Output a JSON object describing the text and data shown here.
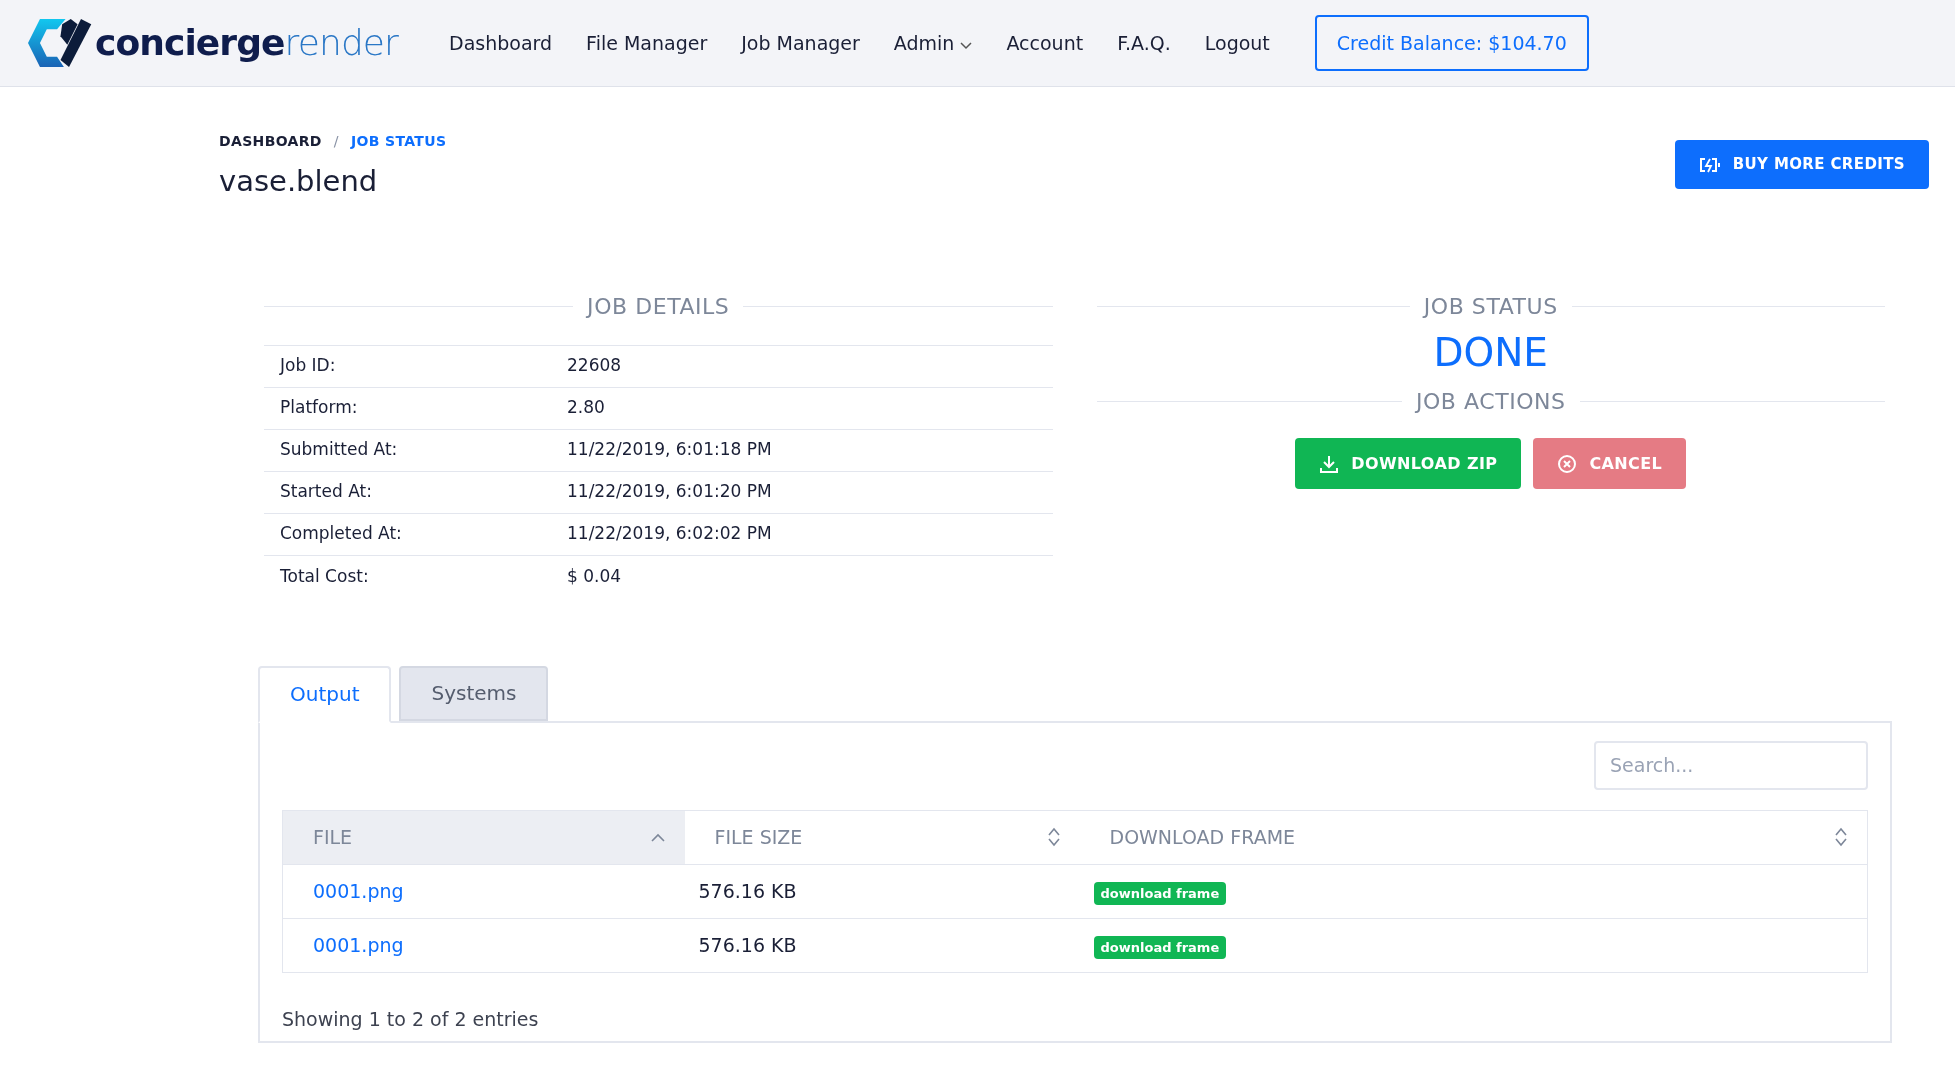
{
  "header": {
    "logo": {
      "bold": "concierge",
      "light": "render"
    },
    "nav": [
      {
        "label": "Dashboard",
        "dropdown": false
      },
      {
        "label": "File Manager",
        "dropdown": false
      },
      {
        "label": "Job Manager",
        "dropdown": false
      },
      {
        "label": "Admin",
        "dropdown": true
      },
      {
        "label": "Account",
        "dropdown": false
      },
      {
        "label": "F.A.Q.",
        "dropdown": false
      },
      {
        "label": "Logout",
        "dropdown": false
      }
    ],
    "credit_balance": "Credit Balance: $104.70"
  },
  "breadcrumb": [
    "DASHBOARD",
    "JOB STATUS"
  ],
  "breadcrumb_separator": "/",
  "title": "vase.blend",
  "buy_button": "BUY MORE CREDITS",
  "job_details": {
    "heading": "JOB DETAILS",
    "rows": [
      {
        "label": "Job ID:",
        "value": "22608"
      },
      {
        "label": "Platform:",
        "value": "2.80"
      },
      {
        "label": "Submitted At:",
        "value": "11/22/2019, 6:01:18 PM"
      },
      {
        "label": "Started At:",
        "value": "11/22/2019, 6:01:20 PM"
      },
      {
        "label": "Completed At:",
        "value": "11/22/2019, 6:02:02 PM"
      },
      {
        "label": "Total Cost:",
        "value": "$ 0.04"
      }
    ]
  },
  "job_status": {
    "heading": "JOB STATUS",
    "status": "DONE"
  },
  "job_actions": {
    "heading": "JOB ACTIONS",
    "buttons": [
      {
        "kind": "download",
        "label": "DOWNLOAD ZIP"
      },
      {
        "kind": "cancel",
        "label": "CANCEL"
      }
    ]
  },
  "tabs": [
    {
      "label": "Output",
      "selected": true
    },
    {
      "label": "Systems",
      "selected": false
    }
  ],
  "search": {
    "placeholder": "Search..."
  },
  "table": {
    "columns": [
      {
        "label": "FILE",
        "sorted": true
      },
      {
        "label": "FILE SIZE",
        "sorted": false
      },
      {
        "label": "DOWNLOAD FRAME",
        "sorted": false
      }
    ],
    "rows": [
      {
        "file": "0001.png",
        "size": "576.16 KB",
        "action": "download frame"
      },
      {
        "file": "0001.png",
        "size": "576.16 KB",
        "action": "download frame"
      }
    ]
  },
  "footer_info": "Showing 1 to 2 of 2 entries"
}
